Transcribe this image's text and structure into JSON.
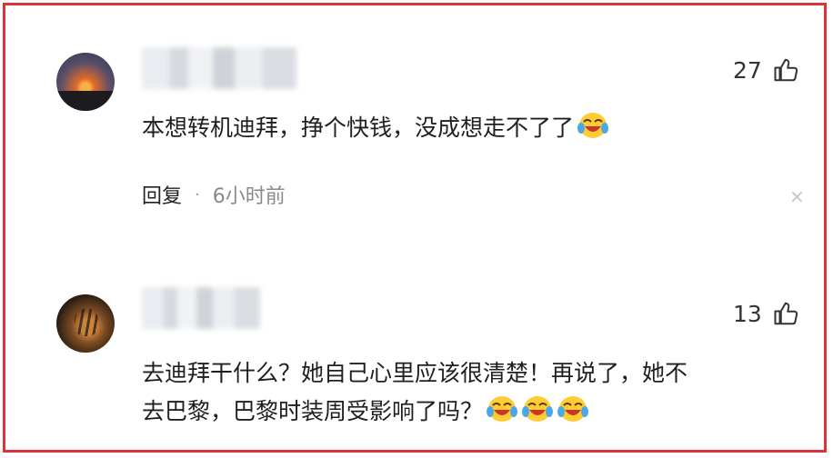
{
  "comments": [
    {
      "likes": "27",
      "text": "本想转机迪拜，挣个快钱，没成想走不了了",
      "reply_label": "回复",
      "separator": "·",
      "time": "6小时前",
      "close_glyph": "×",
      "emoji_count": 1
    },
    {
      "likes": "13",
      "text_line1": "去迪拜干什么？她自己心里应该很清楚！再说了，她不",
      "text_line2": "去巴黎，巴黎时装周受影响了吗？",
      "emoji_count": 3
    }
  ],
  "icons": {
    "like": "thumbs-up-icon",
    "emoji": "laughing-crying-emoji-icon",
    "close": "close-icon"
  },
  "colors": {
    "frame": "#e0303a",
    "text": "#1f1f1f",
    "muted": "#8a8a8a",
    "emoji_face": "#ffcc33"
  }
}
